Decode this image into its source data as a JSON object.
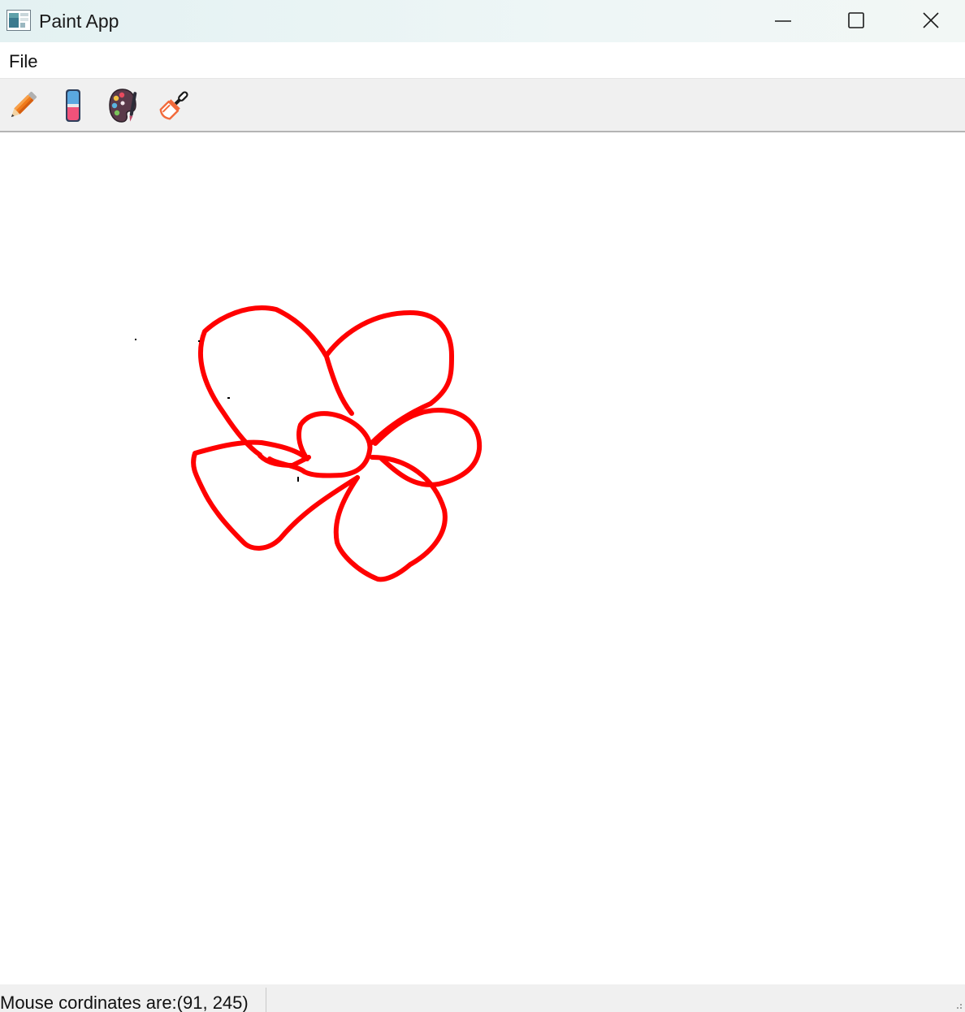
{
  "window": {
    "title": "Paint App",
    "icons": {
      "app": "paint-app-icon",
      "minimize": "minimize-icon",
      "maximize": "maximize-icon",
      "close": "close-icon"
    }
  },
  "menu": {
    "items": [
      {
        "label": "File"
      }
    ]
  },
  "toolbar": {
    "tools": [
      {
        "name": "pencil",
        "icon": "pencil-icon"
      },
      {
        "name": "eraser",
        "icon": "eraser-icon"
      },
      {
        "name": "color-palette",
        "icon": "palette-icon"
      },
      {
        "name": "brush",
        "icon": "brush-icon"
      }
    ]
  },
  "canvas": {
    "stroke_color": "#ff0000",
    "background": "#ffffff"
  },
  "status": {
    "text": "Mouse cordinates are:(91, 245)"
  }
}
